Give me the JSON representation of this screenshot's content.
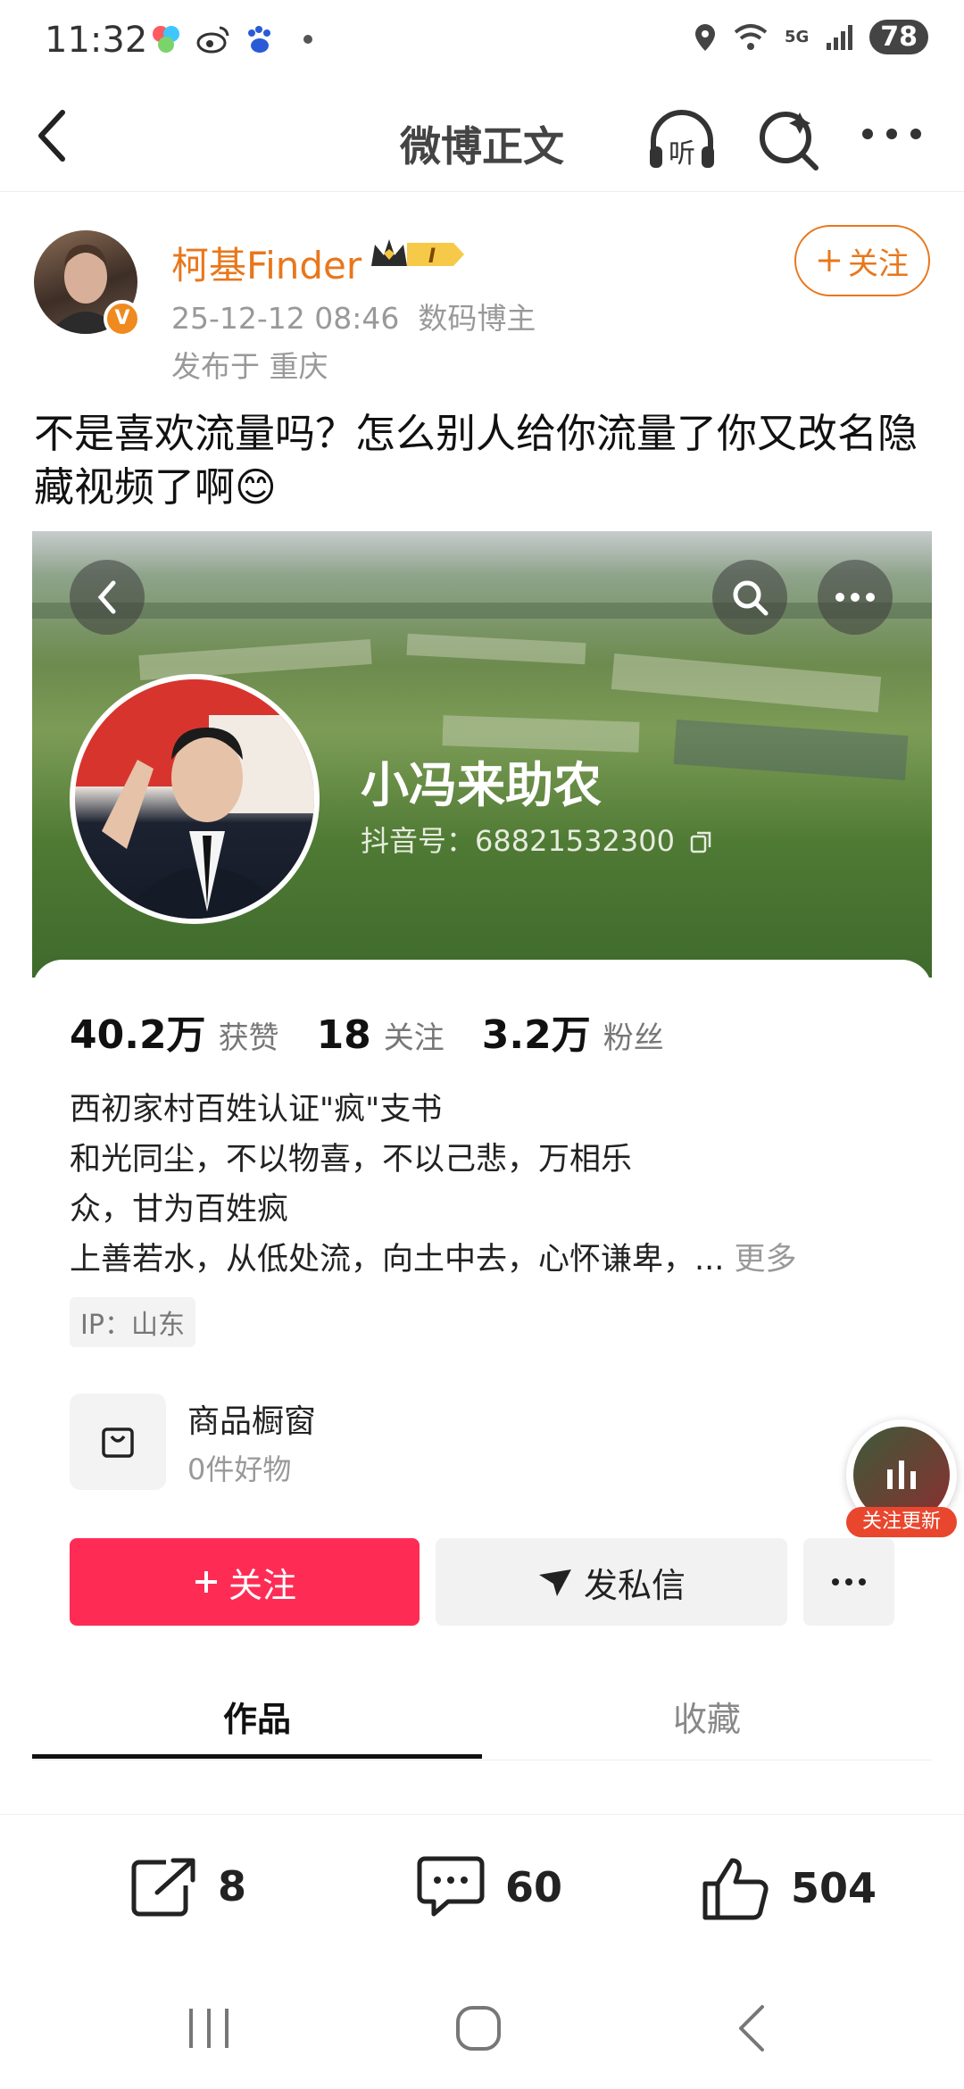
{
  "status_bar": {
    "time": "11:32",
    "battery": "78",
    "network": "5G"
  },
  "nav": {
    "title": "微博正文",
    "listen_label": "听"
  },
  "post": {
    "username": "柯基Finder",
    "level": "I",
    "timestamp": "25-12-12 08:46",
    "category": "数码博主",
    "location": "发布于 重庆",
    "follow_label": "关注",
    "text": "不是喜欢流量吗？怎么别人给你流量了你又改名隐藏视频了啊😊"
  },
  "embedded_profile": {
    "name": "小冯来助农",
    "douyin_id": "抖音号：68821532300",
    "stats": [
      {
        "value": "40.2万",
        "label": "获赞"
      },
      {
        "value": "18",
        "label": "关注"
      },
      {
        "value": "3.2万",
        "label": "粉丝"
      }
    ],
    "bio": {
      "line1": "西初家村百姓认证\"疯\"支书",
      "line2": "和光同尘，不以物喜，不以己悲，万相乐众，甘为百姓疯",
      "line3": "上善若水，从低处流，向土中去，心怀谦卑，...",
      "more": "更多"
    },
    "ip": "IP：山东",
    "shop": {
      "title": "商品橱窗",
      "subtitle": "0件好物"
    },
    "follow_button": "关注",
    "message_button": "发私信",
    "tabs": [
      "作品",
      "收藏"
    ],
    "floating_tag": "关注更新"
  },
  "actions": {
    "repost": "8",
    "comment": "60",
    "like": "504"
  }
}
